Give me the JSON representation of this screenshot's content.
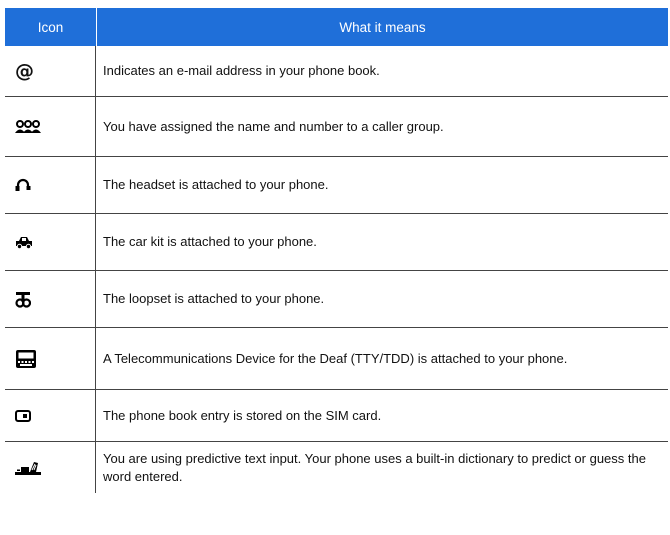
{
  "table": {
    "header_icon": "Icon",
    "header_meaning": "What it means",
    "header_color": "#1f6fd9",
    "rows": [
      {
        "icon": "at-sign-icon",
        "glyph": "@",
        "meaning": "Indicates an e-mail address in your phone book."
      },
      {
        "icon": "caller-group-icon",
        "meaning": "You have assigned the name and number to a caller group."
      },
      {
        "icon": "headset-icon",
        "meaning": "The headset is attached to your phone."
      },
      {
        "icon": "car-icon",
        "meaning": "The car kit is attached to your phone."
      },
      {
        "icon": "loopset-icon",
        "meaning": "The loopset is attached to your phone."
      },
      {
        "icon": "tty-device-icon",
        "meaning": "A Telecommunications Device for the Deaf (TTY/TDD) is attached to your phone."
      },
      {
        "icon": "sim-card-icon",
        "meaning": "The phone book entry is stored on the SIM card."
      },
      {
        "icon": "predictive-text-icon",
        "meaning": "You are using predictive text input. Your phone uses a built-in dictionary to predict or guess the word entered."
      }
    ]
  }
}
